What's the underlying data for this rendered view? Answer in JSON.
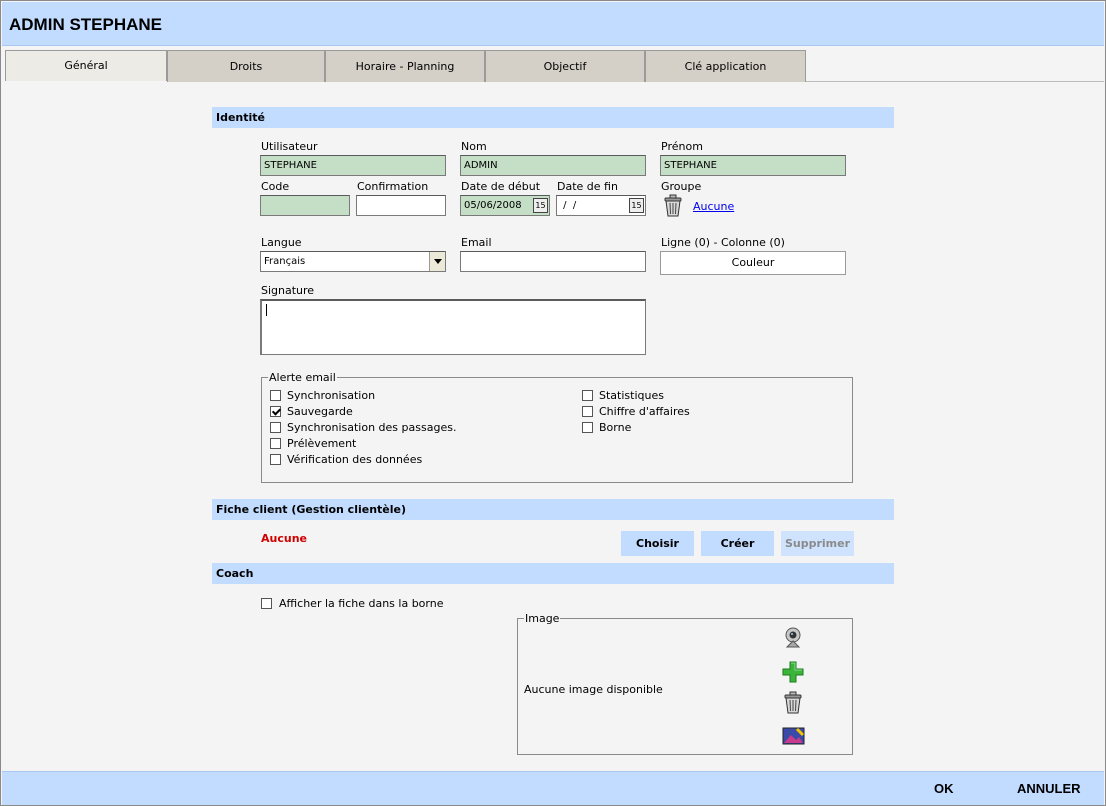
{
  "window": {
    "title": "ADMIN STEPHANE"
  },
  "tabs": [
    {
      "label": "Général",
      "active": true
    },
    {
      "label": "Droits"
    },
    {
      "label": "Horaire - Planning"
    },
    {
      "label": "Objectif"
    },
    {
      "label": "Clé application"
    }
  ],
  "identite": {
    "section_title": "Identité",
    "utilisateur": {
      "label": "Utilisateur",
      "value": "STEPHANE"
    },
    "nom": {
      "label": "Nom",
      "value": "ADMIN"
    },
    "prenom": {
      "label": "Prénom",
      "value": "STEPHANE"
    },
    "code": {
      "label": "Code",
      "value": ""
    },
    "confirmation": {
      "label": "Confirmation",
      "value": ""
    },
    "date_debut": {
      "label": "Date de début",
      "value": "05/06/2008",
      "icon_text": "15"
    },
    "date_fin": {
      "label": "Date de fin",
      "value": " /  /",
      "icon_text": "15"
    },
    "groupe": {
      "label": "Groupe",
      "value": "Aucune"
    },
    "langue": {
      "label": "Langue",
      "value": "Français"
    },
    "email": {
      "label": "Email",
      "value": ""
    },
    "ligne_colonne": {
      "label": "Ligne (0) - Colonne (0)"
    },
    "couleur_button": "Couleur",
    "signature": {
      "label": "Signature",
      "value": ""
    }
  },
  "alerte_email": {
    "legend": "Alerte email",
    "items": [
      {
        "label": "Synchronisation",
        "checked": false
      },
      {
        "label": "Sauvegarde",
        "checked": true
      },
      {
        "label": "Synchronisation des passages.",
        "checked": false
      },
      {
        "label": "Prélèvement",
        "checked": false
      },
      {
        "label": "Vérification des données",
        "checked": false
      },
      {
        "label": "Statistiques",
        "checked": false
      },
      {
        "label": "Chiffre d'affaires",
        "checked": false
      },
      {
        "label": "Borne",
        "checked": false
      }
    ]
  },
  "fiche_client": {
    "section_title": "Fiche client (Gestion clientèle)",
    "value": "Aucune",
    "buttons": {
      "choisir": "Choisir",
      "creer": "Créer",
      "supprimer": "Supprimer"
    }
  },
  "coach": {
    "section_title": "Coach",
    "afficher_fiche": {
      "label": "Afficher la fiche dans la borne",
      "checked": false
    },
    "image": {
      "legend": "Image",
      "empty_text": "Aucune image disponible",
      "icons": [
        "webcam-icon",
        "add-icon",
        "trash-icon",
        "image-edit-icon"
      ]
    }
  },
  "footer": {
    "ok": "OK",
    "annuler": "ANNULER"
  },
  "colors": {
    "accent": "#c2dcff",
    "field_green": "#c4dfc6",
    "error_red": "#d00000"
  }
}
